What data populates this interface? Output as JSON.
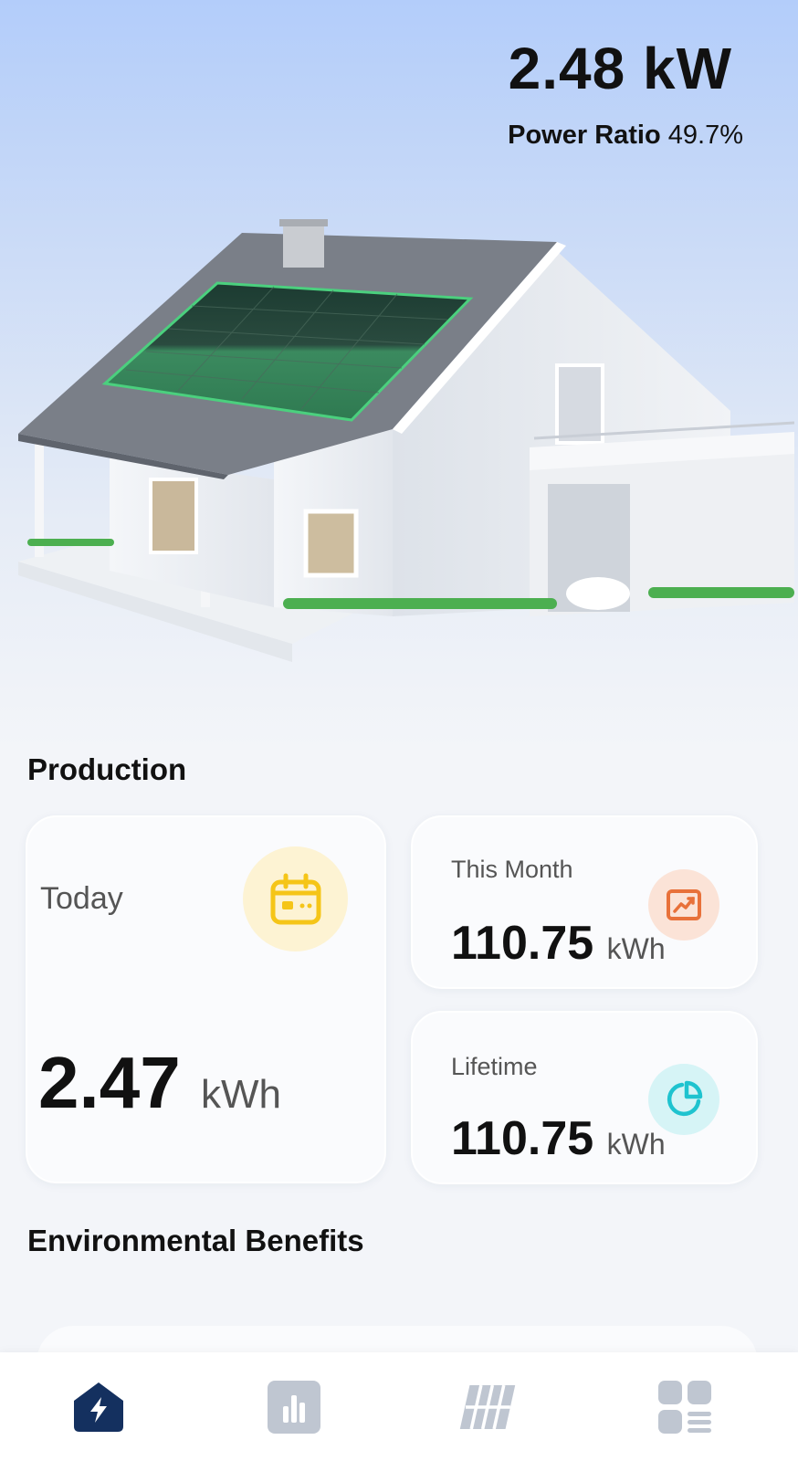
{
  "header": {
    "power": "2.48 kW",
    "ratio_label": "Power Ratio",
    "ratio_value": "49.7%"
  },
  "production": {
    "title": "Production",
    "today": {
      "label": "Today",
      "value": "2.47",
      "unit": "kWh",
      "icon": "calendar-icon"
    },
    "this_month": {
      "label": "This Month",
      "value": "110.75",
      "unit": "kWh",
      "icon": "trend-chart-icon"
    },
    "lifetime": {
      "label": "Lifetime",
      "value": "110.75",
      "unit": "kWh",
      "icon": "pie-chart-icon"
    }
  },
  "environment": {
    "title": "Environmental Benefits"
  },
  "nav": {
    "items": [
      {
        "icon": "home-energy-icon",
        "active": true
      },
      {
        "icon": "bar-chart-icon",
        "active": false
      },
      {
        "icon": "solar-panel-icon",
        "active": false
      },
      {
        "icon": "grid-menu-icon",
        "active": false
      }
    ]
  },
  "colors": {
    "accent": "#14305f",
    "today_icon": "#f5c518",
    "month_icon": "#e8713a",
    "lifetime_icon": "#1fc3cf",
    "inactive_nav": "#bfc6d1"
  }
}
